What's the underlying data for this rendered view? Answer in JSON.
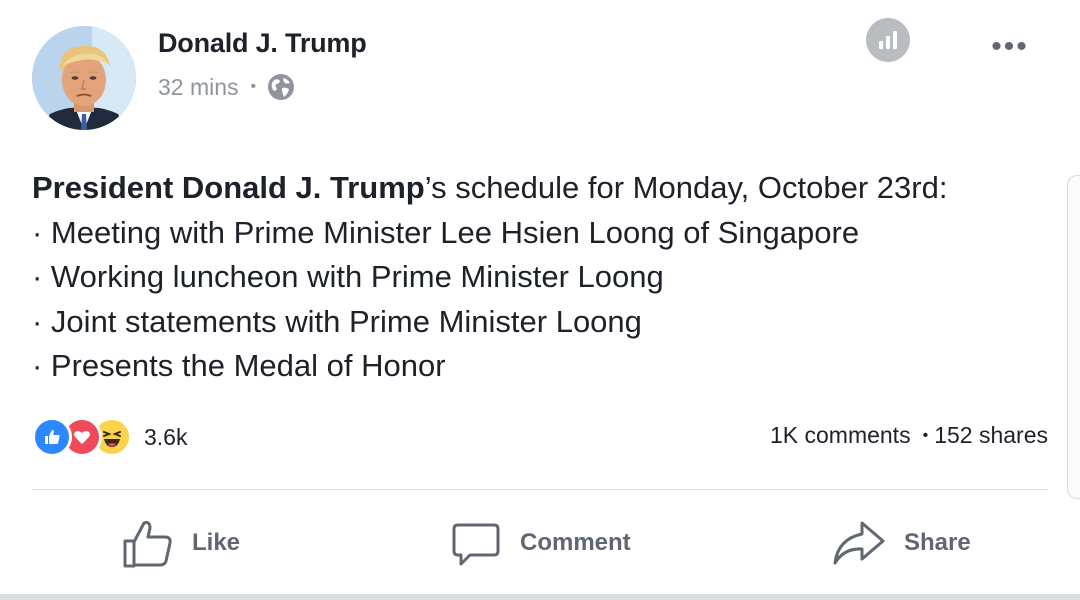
{
  "post": {
    "author": "Donald J. Trump",
    "timestamp": "32 mins",
    "meta_separator": "•",
    "privacy_icon": "globe-icon",
    "insights_icon": "bar-chart-icon",
    "more_label": "•••",
    "text": {
      "bold_name": "President Donald J. Trump",
      "intro_rest": "’s schedule for Monday, October 23rd:",
      "items": [
        "· Meeting with Prime Minister Lee Hsien Loong of Singapore",
        "· Working luncheon with Prime Minister Loong",
        "· Joint statements with Prime Minister Loong",
        "· Presents the Medal of Honor"
      ]
    },
    "reactions": {
      "icons": [
        "like-reaction-icon",
        "love-reaction-icon",
        "haha-reaction-icon"
      ],
      "count": "3.6k"
    },
    "comments": "1K comments",
    "count_separator": "•",
    "shares": "152 shares"
  },
  "actions": {
    "like": "Like",
    "comment": "Comment",
    "share": "Share"
  },
  "colors": {
    "text": "#1d2129",
    "meta": "#90949c",
    "action": "#606770",
    "like_blue": "#2d88ff",
    "love_red": "#f0495b",
    "haha_yellow": "#fcd34d"
  }
}
